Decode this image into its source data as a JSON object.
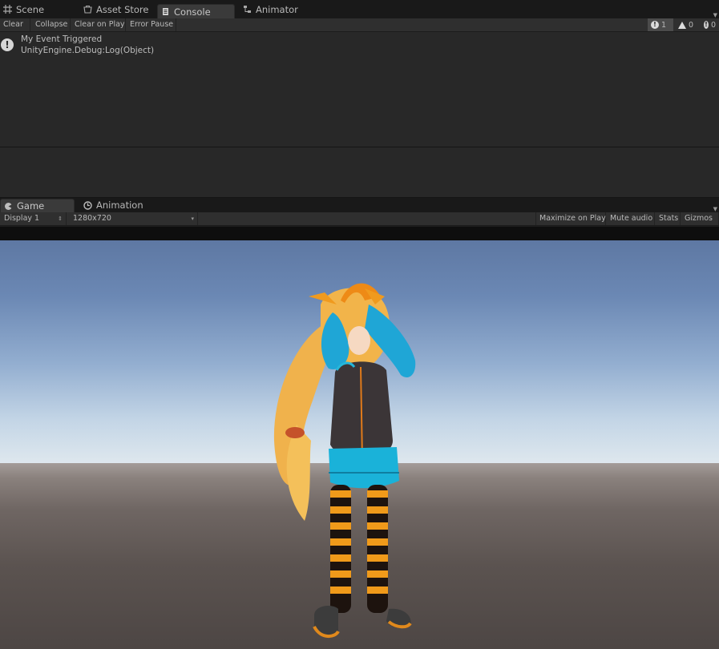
{
  "top_tabs": [
    {
      "label": "Scene",
      "icon": "grid-icon"
    },
    {
      "label": "Asset Store",
      "icon": "store-icon"
    },
    {
      "label": "Console",
      "icon": "console-icon"
    },
    {
      "label": "Animator",
      "icon": "animator-icon"
    }
  ],
  "console_toolbar": {
    "clear": "Clear",
    "collapse": "Collapse",
    "clear_on_play": "Clear on Play",
    "error_pause": "Error Pause",
    "info_count": "1",
    "warning_count": "0",
    "error_count": "0"
  },
  "log_entries": [
    {
      "line1": "My Event Triggered",
      "line2": "UnityEngine.Debug:Log(Object)",
      "icon": "info-icon"
    }
  ],
  "bottom_tabs": [
    {
      "label": "Game",
      "icon": "game-icon"
    },
    {
      "label": "Animation",
      "icon": "animation-icon"
    }
  ],
  "game_toolbar": {
    "display": "Display 1",
    "resolution": "1280x720",
    "maximize": "Maximize on Play",
    "mute": "Mute audio",
    "stats": "Stats",
    "gizmos": "Gizmos"
  },
  "colors": {
    "panel_bg": "#282828",
    "toolbar_bg": "#2f2f2f",
    "tabbar_bg": "#191919",
    "active_tab": "#3a3a3a",
    "sky_top": "#5e78a3",
    "horizon": "#dfe8ee",
    "ground": "#5b5350"
  }
}
